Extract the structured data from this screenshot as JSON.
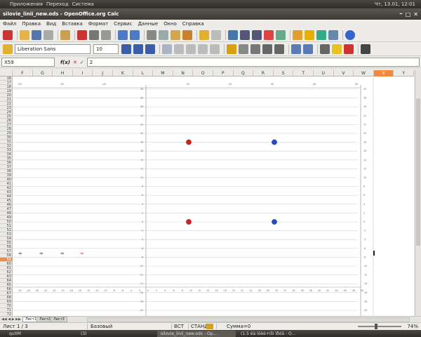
{
  "top_panel": {
    "menus": [
      "Приложения",
      "Переход",
      "Система"
    ],
    "clock": "Чт, 13.01, 12:01"
  },
  "window": {
    "title": "silovie_linii_new.ods - OpenOffice.org Calc"
  },
  "menu_bar": [
    "Файл",
    "Правка",
    "Вид",
    "Вставка",
    "Формат",
    "Сервис",
    "Данные",
    "Окно",
    "Справка"
  ],
  "format_toolbar": {
    "font_name": "Liberation Sans",
    "font_size": "10"
  },
  "formula_bar": {
    "cell_ref": "X59",
    "content": "2"
  },
  "columns": [
    "F",
    "G",
    "H",
    "I",
    "J",
    "K",
    "L",
    "M",
    "N",
    "O",
    "P",
    "Q",
    "R",
    "S",
    "T",
    "U",
    "V",
    "W",
    "X",
    "Y"
  ],
  "selected_column": "X",
  "selected_row": "59",
  "rows": [
    "16",
    "17",
    "18",
    "19",
    "20",
    "21",
    "22",
    "23",
    "24",
    "25",
    "26",
    "27",
    "28",
    "29",
    "30",
    "31",
    "32",
    "33",
    "34",
    "35",
    "36",
    "37",
    "38",
    "39",
    "40",
    "41",
    "42",
    "43",
    "44",
    "45",
    "46",
    "47",
    "48",
    "49",
    "50",
    "51",
    "52",
    "53",
    "54",
    "55",
    "56",
    "57",
    "58",
    "59",
    "60",
    "61",
    "62",
    "63",
    "64",
    "65",
    "66",
    "67",
    "68",
    "69",
    "70",
    "71",
    "72",
    "73"
  ],
  "chart": {
    "top_axis_labels": [
      "-40",
      "-30",
      "-20",
      "10",
      "20",
      "30",
      "40",
      "50"
    ],
    "bottom_axis_labels": [
      "-30",
      "-28",
      "-26",
      "-24",
      "-22",
      "-20",
      "-18",
      "-16",
      "-14",
      "-12",
      "-10",
      "-8",
      "-6",
      "-4",
      "-2",
      "0",
      "2",
      "4",
      "6",
      "8",
      "10",
      "12",
      "14",
      "16",
      "18",
      "20",
      "22",
      "24",
      "26",
      "28",
      "30",
      "32",
      "34",
      "36",
      "38",
      "40",
      "42",
      "44",
      "46",
      "48",
      "50"
    ],
    "y_axis_labels": [
      "30",
      "28",
      "26",
      "24",
      "22",
      "20",
      "18",
      "16",
      "14",
      "12",
      "10",
      "8",
      "6",
      "4",
      "2",
      "0",
      "-2",
      "-4",
      "-6",
      "-8",
      "-10",
      "-12",
      "-14",
      "-16",
      "-18",
      "-20"
    ],
    "right_axis_labels": [
      "30",
      "28",
      "26",
      "24",
      "22",
      "20",
      "18",
      "16",
      "14",
      "12",
      "10",
      "8",
      "6",
      "4",
      "2",
      "0",
      "-2",
      "-4",
      "-6",
      "-8",
      "-10",
      "-12",
      "-14",
      "-16",
      "-18",
      "-20"
    ],
    "red_points": [
      {
        "x": 10,
        "y": 20
      },
      {
        "x": 10,
        "y": 10
      }
    ],
    "blue_points": [
      {
        "x": 30,
        "y": 20
      },
      {
        "x": 30,
        "y": 10
      }
    ]
  },
  "sheet_tabs": [
    "Лист1",
    "Лист2",
    "Лист3"
  ],
  "status_bar": {
    "sheet": "Лист 1 / 3",
    "style": "Базовый",
    "insert_mode": "ВСТ",
    "selection_mode": "СТАНД",
    "sum": "Сумма=0",
    "zoom": "74%"
  },
  "taskbar": {
    "items": [
      "qutIM",
      "(3)",
      "silovie_linii_new.ods - Op...",
      "(1.5 ëä ïóëè+ííìi ïðóä - O..."
    ]
  },
  "colors": {
    "red_point": "#d42020",
    "blue_point": "#1f4fc8",
    "selected": "#f08a3c"
  }
}
